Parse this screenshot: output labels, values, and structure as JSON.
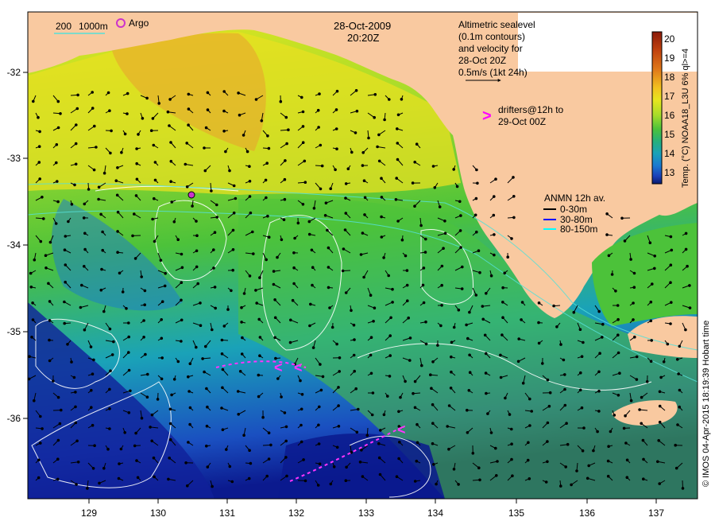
{
  "header": {
    "date": "28-Oct-2009",
    "time": "20:20Z"
  },
  "bathymetry_legend": {
    "label_200": "200",
    "label_1000": "1000m",
    "color": "#55e0d8"
  },
  "argo_legend": {
    "label": "Argo",
    "color": "#cc33cc"
  },
  "altimetry_note": [
    "Altimetric sealevel",
    "(0.1m contours)",
    "and velocity for",
    "28-Oct 20Z",
    "0.5m/s (1kt 24h)"
  ],
  "drifters_note": {
    "symbol": ">",
    "lines": [
      "drifters@12h to",
      "29-Oct 00Z"
    ],
    "color": "#ff00ff"
  },
  "anmn_legend": {
    "title": "ANMN 12h av.",
    "items": [
      {
        "label": "0-30m",
        "color": "#000000"
      },
      {
        "label": "30-80m",
        "color": "#0000ff"
      },
      {
        "label": "80-150m",
        "color": "#00ffff"
      }
    ]
  },
  "colorbar": {
    "ticks": [
      "20",
      "19",
      "18",
      "17",
      "16",
      "15",
      "14",
      "13"
    ],
    "title": "Temp. (°C) NOAA18_L3U 6% ql>=4",
    "colors": [
      "#8b1a0a",
      "#c0420f",
      "#e07a1a",
      "#f2c21f",
      "#e6e61f",
      "#a6dc2a",
      "#4cc23a",
      "#26b07a",
      "#1aa2b8",
      "#1a7ad0",
      "#1a40b8",
      "#0b1a6e"
    ]
  },
  "land": {
    "color": "#f9c9a0"
  },
  "axes": {
    "x_ticks": [
      "129",
      "130",
      "131",
      "132",
      "133",
      "134",
      "135",
      "136",
      "137"
    ],
    "y_ticks": [
      "-32",
      "-33",
      "-34",
      "-35",
      "-36"
    ]
  },
  "credit": "© IMOS 04-Apr-2015 18:19:39 Hobart time"
}
